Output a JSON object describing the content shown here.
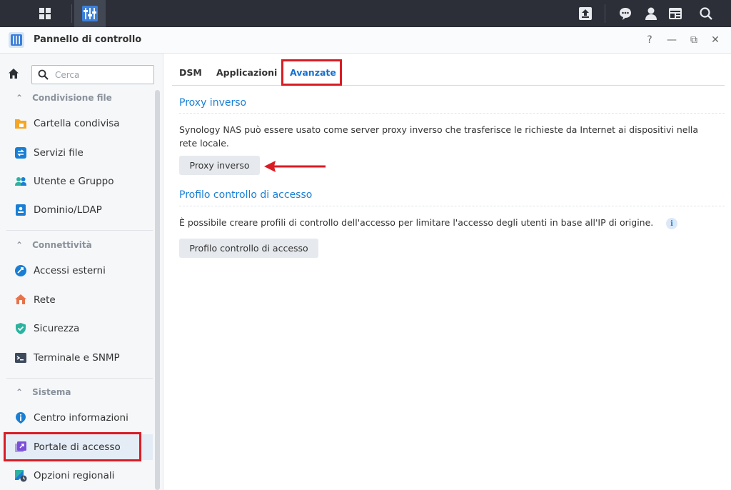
{
  "window": {
    "title": "Pannello di controllo"
  },
  "window_controls": {
    "help": "?",
    "minimize": "—",
    "restore": "⧉",
    "close": "✕"
  },
  "search": {
    "placeholder": "Cerca"
  },
  "sidebar": {
    "sections": [
      {
        "label": "Condivisione file",
        "items": [
          "Cartella condivisa",
          "Servizi file",
          "Utente e Gruppo",
          "Dominio/LDAP"
        ]
      },
      {
        "label": "Connettività",
        "items": [
          "Accessi esterni",
          "Rete",
          "Sicurezza",
          "Terminale e SNMP"
        ]
      },
      {
        "label": "Sistema",
        "items": [
          "Centro informazioni",
          "Portale di accesso",
          "Opzioni regionali"
        ]
      }
    ],
    "selected": "Portale di accesso"
  },
  "tabs": [
    {
      "label": "DSM"
    },
    {
      "label": "Applicazioni"
    },
    {
      "label": "Avanzate"
    }
  ],
  "active_tab": "Avanzate",
  "reverse_proxy": {
    "title": "Proxy inverso",
    "description_line1": "Synology NAS può essere usato come server proxy inverso che trasferisce le richieste da Internet ai dispositivi nella",
    "description_line2": "rete locale.",
    "button": "Proxy inverso"
  },
  "access_control": {
    "title": "Profilo controllo di accesso",
    "description": "È possibile creare profili di controllo dell'accesso per limitare l'accesso degli utenti in base all'IP di origine.",
    "button": "Profilo controllo di accesso",
    "info_glyph": "i"
  },
  "colors": {
    "accent": "#1570d0",
    "highlight": "#d91c24",
    "taskbar": "#2c2f38"
  },
  "icons": [
    "apps-grid-icon",
    "control-panel-icon",
    "upload-icon",
    "chat-icon",
    "user-icon",
    "widgets-icon",
    "search-icon"
  ]
}
